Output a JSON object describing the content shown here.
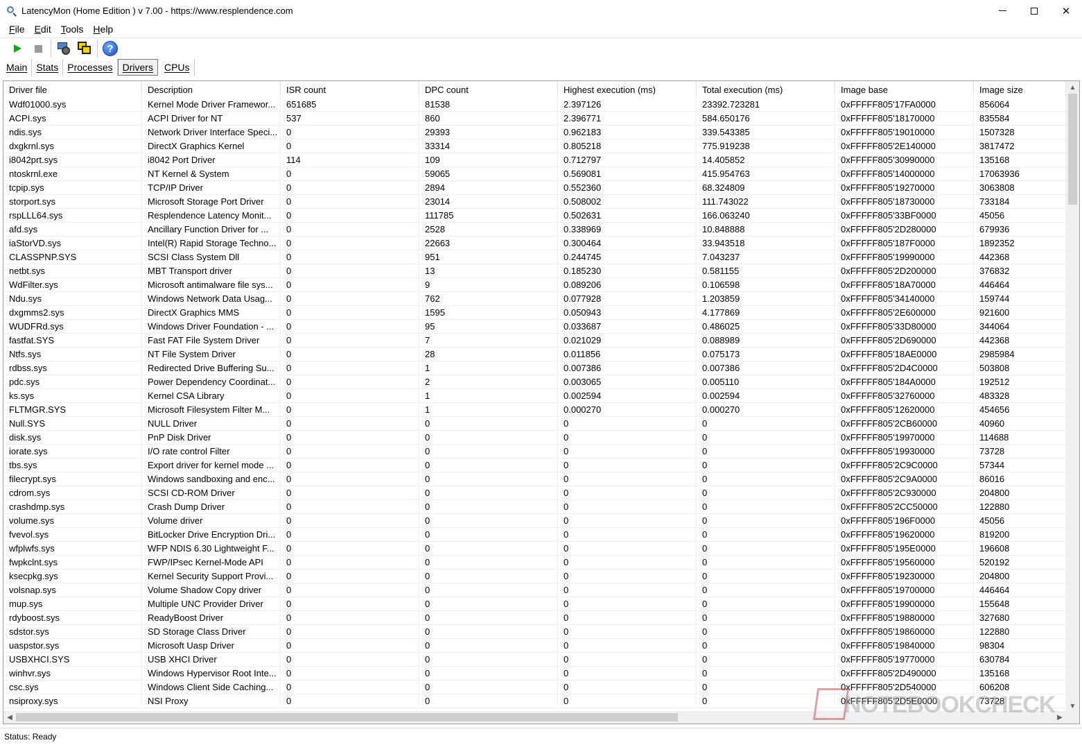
{
  "window": {
    "title": "LatencyMon  (Home Edition )  v 7.00 - https://www.resplendence.com"
  },
  "menu": [
    {
      "key": "F",
      "rest": "ile"
    },
    {
      "key": "E",
      "rest": "dit"
    },
    {
      "key": "T",
      "rest": "ools"
    },
    {
      "key": "H",
      "rest": "elp"
    }
  ],
  "toolbar": {
    "help_glyph": "?"
  },
  "tabs": [
    "Main",
    "Stats",
    "Processes",
    "Drivers",
    "CPUs"
  ],
  "active_tab": "Drivers",
  "table": {
    "columns": [
      "Driver file",
      "Description",
      "ISR count",
      "DPC count",
      "Highest execution (ms)",
      "Total execution (ms)",
      "Image base",
      "Image size"
    ],
    "rows": [
      [
        "Wdf01000.sys",
        "Kernel Mode Driver Framewor...",
        "651685",
        "81538",
        "2.397126",
        "23392.723281",
        "0xFFFFF805'17FA0000",
        "856064"
      ],
      [
        "ACPI.sys",
        "ACPI Driver for NT",
        "537",
        "860",
        "2.396771",
        "584.650176",
        "0xFFFFF805'18170000",
        "835584"
      ],
      [
        "ndis.sys",
        "Network Driver Interface Speci...",
        "0",
        "29393",
        "0.962183",
        "339.543385",
        "0xFFFFF805'19010000",
        "1507328"
      ],
      [
        "dxgkrnl.sys",
        "DirectX Graphics Kernel",
        "0",
        "33314",
        "0.805218",
        "775.919238",
        "0xFFFFF805'2E140000",
        "3817472"
      ],
      [
        "i8042prt.sys",
        "i8042 Port Driver",
        "114",
        "109",
        "0.712797",
        "14.405852",
        "0xFFFFF805'30990000",
        "135168"
      ],
      [
        "ntoskrnl.exe",
        "NT Kernel & System",
        "0",
        "59065",
        "0.569081",
        "415.954763",
        "0xFFFFF805'14000000",
        "17063936"
      ],
      [
        "tcpip.sys",
        "TCP/IP Driver",
        "0",
        "2894",
        "0.552360",
        "68.324809",
        "0xFFFFF805'19270000",
        "3063808"
      ],
      [
        "storport.sys",
        "Microsoft Storage Port Driver",
        "0",
        "23014",
        "0.508002",
        "111.743022",
        "0xFFFFF805'18730000",
        "733184"
      ],
      [
        "rspLLL64.sys",
        "Resplendence Latency Monit...",
        "0",
        "111785",
        "0.502631",
        "166.063240",
        "0xFFFFF805'33BF0000",
        "45056"
      ],
      [
        "afd.sys",
        "Ancillary Function Driver for ...",
        "0",
        "2528",
        "0.338969",
        "10.848888",
        "0xFFFFF805'2D280000",
        "679936"
      ],
      [
        "iaStorVD.sys",
        "Intel(R) Rapid Storage Techno...",
        "0",
        "22663",
        "0.300464",
        "33.943518",
        "0xFFFFF805'187F0000",
        "1892352"
      ],
      [
        "CLASSPNP.SYS",
        "SCSI Class System Dll",
        "0",
        "951",
        "0.244745",
        "7.043237",
        "0xFFFFF805'19990000",
        "442368"
      ],
      [
        "netbt.sys",
        "MBT Transport driver",
        "0",
        "13",
        "0.185230",
        "0.581155",
        "0xFFFFF805'2D200000",
        "376832"
      ],
      [
        "WdFilter.sys",
        "Microsoft antimalware file sys...",
        "0",
        "9",
        "0.089206",
        "0.106598",
        "0xFFFFF805'18A70000",
        "446464"
      ],
      [
        "Ndu.sys",
        "Windows Network Data Usag...",
        "0",
        "762",
        "0.077928",
        "1.203859",
        "0xFFFFF805'34140000",
        "159744"
      ],
      [
        "dxgmms2.sys",
        "DirectX Graphics MMS",
        "0",
        "1595",
        "0.050943",
        "4.177869",
        "0xFFFFF805'2E600000",
        "921600"
      ],
      [
        "WUDFRd.sys",
        "Windows Driver Foundation - ...",
        "0",
        "95",
        "0.033687",
        "0.486025",
        "0xFFFFF805'33D80000",
        "344064"
      ],
      [
        "fastfat.SYS",
        "Fast FAT File System Driver",
        "0",
        "7",
        "0.021029",
        "0.088989",
        "0xFFFFF805'2D690000",
        "442368"
      ],
      [
        "Ntfs.sys",
        "NT File System Driver",
        "0",
        "28",
        "0.011856",
        "0.075173",
        "0xFFFFF805'18AE0000",
        "2985984"
      ],
      [
        "rdbss.sys",
        "Redirected Drive Buffering Su...",
        "0",
        "1",
        "0.007386",
        "0.007386",
        "0xFFFFF805'2D4C0000",
        "503808"
      ],
      [
        "pdc.sys",
        "Power Dependency Coordinat...",
        "0",
        "2",
        "0.003065",
        "0.005110",
        "0xFFFFF805'184A0000",
        "192512"
      ],
      [
        "ks.sys",
        "Kernel CSA Library",
        "0",
        "1",
        "0.002594",
        "0.002594",
        "0xFFFFF805'32760000",
        "483328"
      ],
      [
        "FLTMGR.SYS",
        "Microsoft Filesystem Filter M...",
        "0",
        "1",
        "0.000270",
        "0.000270",
        "0xFFFFF805'12620000",
        "454656"
      ],
      [
        "Null.SYS",
        "NULL Driver",
        "0",
        "0",
        "0",
        "0",
        "0xFFFFF805'2CB60000",
        "40960"
      ],
      [
        "disk.sys",
        "PnP Disk Driver",
        "0",
        "0",
        "0",
        "0",
        "0xFFFFF805'19970000",
        "114688"
      ],
      [
        "iorate.sys",
        "I/O rate control Filter",
        "0",
        "0",
        "0",
        "0",
        "0xFFFFF805'19930000",
        "73728"
      ],
      [
        "tbs.sys",
        "Export driver for kernel mode ...",
        "0",
        "0",
        "0",
        "0",
        "0xFFFFF805'2C9C0000",
        "57344"
      ],
      [
        "filecrypt.sys",
        "Windows sandboxing and enc...",
        "0",
        "0",
        "0",
        "0",
        "0xFFFFF805'2C9A0000",
        "86016"
      ],
      [
        "cdrom.sys",
        "SCSI CD-ROM Driver",
        "0",
        "0",
        "0",
        "0",
        "0xFFFFF805'2C930000",
        "204800"
      ],
      [
        "crashdmp.sys",
        "Crash Dump Driver",
        "0",
        "0",
        "0",
        "0",
        "0xFFFFF805'2CC50000",
        "122880"
      ],
      [
        "volume.sys",
        "Volume driver",
        "0",
        "0",
        "0",
        "0",
        "0xFFFFF805'196F0000",
        "45056"
      ],
      [
        "fvevol.sys",
        "BitLocker Drive Encryption Dri...",
        "0",
        "0",
        "0",
        "0",
        "0xFFFFF805'19620000",
        "819200"
      ],
      [
        "wfplwfs.sys",
        "WFP NDIS 6.30 Lightweight F...",
        "0",
        "0",
        "0",
        "0",
        "0xFFFFF805'195E0000",
        "196608"
      ],
      [
        "fwpkclnt.sys",
        "FWP/IPsec Kernel-Mode API",
        "0",
        "0",
        "0",
        "0",
        "0xFFFFF805'19560000",
        "520192"
      ],
      [
        "ksecpkg.sys",
        "Kernel Security Support Provi...",
        "0",
        "0",
        "0",
        "0",
        "0xFFFFF805'19230000",
        "204800"
      ],
      [
        "volsnap.sys",
        "Volume Shadow Copy driver",
        "0",
        "0",
        "0",
        "0",
        "0xFFFFF805'19700000",
        "446464"
      ],
      [
        "mup.sys",
        "Multiple UNC Provider Driver",
        "0",
        "0",
        "0",
        "0",
        "0xFFFFF805'19900000",
        "155648"
      ],
      [
        "rdyboost.sys",
        "ReadyBoost Driver",
        "0",
        "0",
        "0",
        "0",
        "0xFFFFF805'19880000",
        "327680"
      ],
      [
        "sdstor.sys",
        "SD Storage Class Driver",
        "0",
        "0",
        "0",
        "0",
        "0xFFFFF805'19860000",
        "122880"
      ],
      [
        "uaspstor.sys",
        "Microsoft Uasp Driver",
        "0",
        "0",
        "0",
        "0",
        "0xFFFFF805'19840000",
        "98304"
      ],
      [
        "USBXHCI.SYS",
        "USB XHCI Driver",
        "0",
        "0",
        "0",
        "0",
        "0xFFFFF805'19770000",
        "630784"
      ],
      [
        "winhvr.sys",
        "Windows Hypervisor Root Inte...",
        "0",
        "0",
        "0",
        "0",
        "0xFFFFF805'2D490000",
        "135168"
      ],
      [
        "csc.sys",
        "Windows Client Side Caching...",
        "0",
        "0",
        "0",
        "0",
        "0xFFFFF805'2D540000",
        "606208"
      ],
      [
        "nsiproxy.sys",
        "NSI Proxy",
        "0",
        "0",
        "0",
        "0",
        "0xFFFFF805'2D5E0000",
        "73728"
      ]
    ]
  },
  "status": {
    "text": "Status: Ready"
  },
  "watermark": {
    "text": "NOTEBOOKCHECK"
  }
}
